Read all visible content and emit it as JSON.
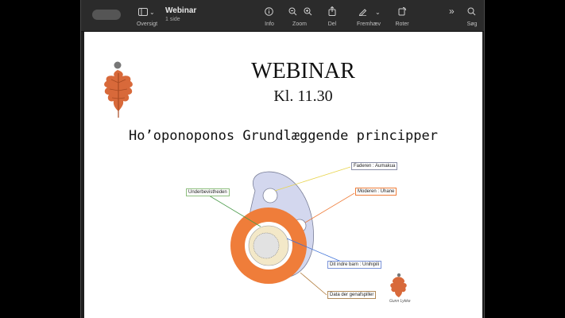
{
  "toolbar": {
    "doc_title": "Webinar",
    "doc_subtitle": "1 side",
    "sidebar_label": "Oversigt",
    "info_label": "Info",
    "zoom_label": "Zoom",
    "share_label": "Del",
    "highlight_label": "Fremhæv",
    "rotate_label": "Roter",
    "search_label": "Søg"
  },
  "slide": {
    "heading": "WEBINAR",
    "time": "Kl. 11.30",
    "subtitle": "Ho’oponoponos Grundlæggende principper",
    "labels": {
      "underbevidstheden": "Underbevistheden",
      "faderen": "Faderen : Aumakua",
      "moderen": "Moderen : Uhane",
      "indre_barn": "Dit indre barn : Unihipili",
      "data": "Data der genafspiller"
    },
    "signature": "Gunn Lykke"
  },
  "colors": {
    "leaf_orange": "#d8693a",
    "ring_orange": "#ef7d3a",
    "blob_lavender": "#d3d7ee",
    "label_border_green": "#8fbf7f",
    "label_border_gray": "#8a8fa8"
  }
}
